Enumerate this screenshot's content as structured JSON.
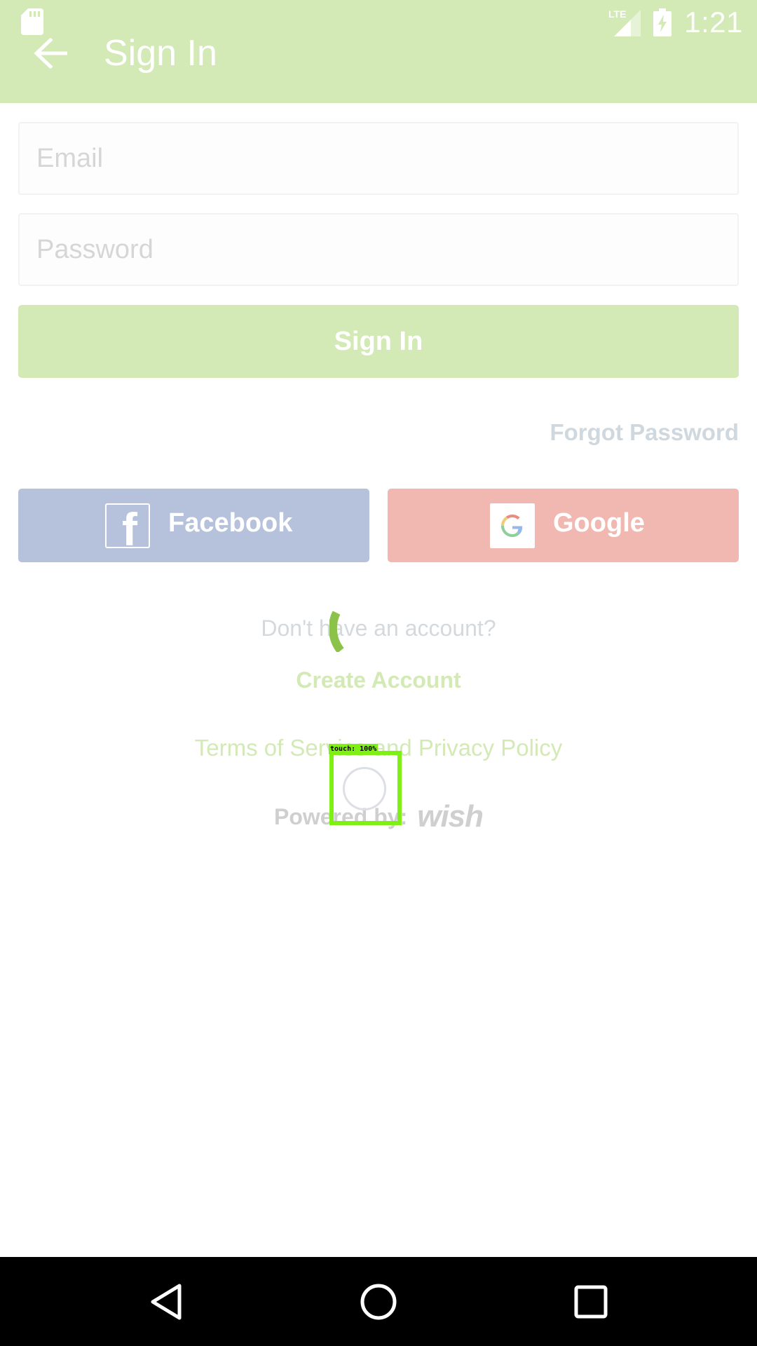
{
  "status_bar": {
    "network": "LTE",
    "time": "1:21",
    "icons": [
      "sd-card-icon",
      "signal-icon",
      "battery-charging-icon"
    ]
  },
  "app_bar": {
    "title": "Sign In",
    "back_icon": "arrow-back-icon"
  },
  "form": {
    "email_placeholder": "Email",
    "email_value": "",
    "password_placeholder": "Password",
    "password_value": "",
    "signin_label": "Sign In",
    "forgot_password": "Forgot Password"
  },
  "social": {
    "facebook_label": "Facebook",
    "google_label": "Google"
  },
  "footer": {
    "no_account": "Don't have an account?",
    "create_account": "Create Account",
    "terms": "Terms of Service and Privacy Policy",
    "powered_by": "Powered by:",
    "brand": "wish"
  },
  "touch_overlay": {
    "label": "touch: 100%"
  },
  "nav_bar": {
    "buttons": [
      "back-triangle-icon",
      "home-circle-icon",
      "recents-square-icon"
    ]
  },
  "colors": {
    "accent": "#d3e9b6",
    "facebook": "#b6c1dc",
    "google": "#f0b8b1",
    "spinner": "#8bc34a",
    "touch": "#7ff014"
  }
}
